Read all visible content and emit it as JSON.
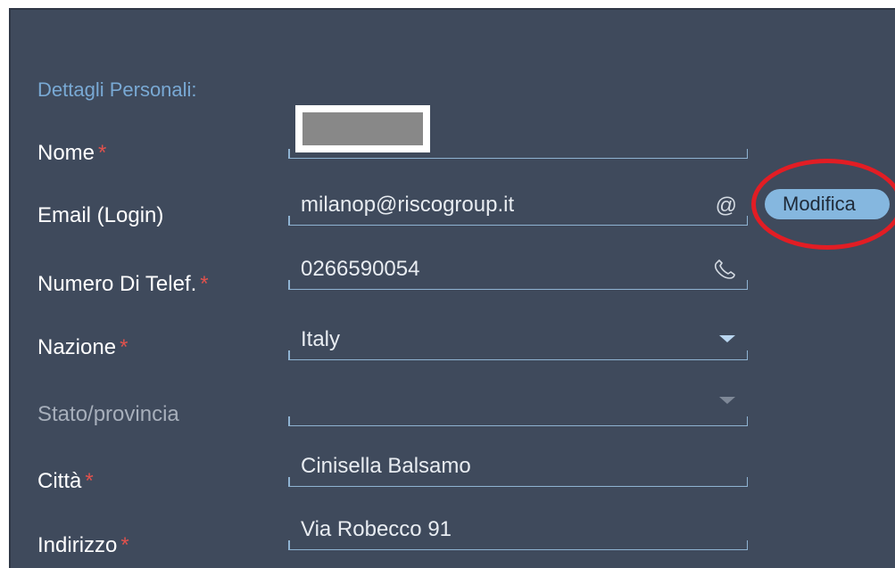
{
  "section": {
    "title": "Dettagli Personali:"
  },
  "required_marker": "*",
  "fields": {
    "nome": {
      "label": "Nome",
      "value": ""
    },
    "email": {
      "label": "Email (Login)",
      "value": "milanop@riscogroup.it",
      "icon": "at-icon",
      "icon_glyph": "@"
    },
    "telefono": {
      "label": "Numero Di Telef.",
      "value": "0266590054",
      "icon": "phone-icon"
    },
    "nazione": {
      "label": "Nazione",
      "value": "Italy"
    },
    "stato": {
      "label": "Stato/provincia",
      "value": ""
    },
    "citta": {
      "label": "Città",
      "value": "Cinisella Balsamo"
    },
    "indirizzo": {
      "label": "Indirizzo",
      "value": "Via Robecco 91"
    }
  },
  "buttons": {
    "modifica": "Modifica"
  },
  "colors": {
    "panel_background": "#3f4a5c",
    "accent": "#79a9d4",
    "required": "#e0524d",
    "button": "#85b7df",
    "annotation_circle": "#e21d24"
  }
}
